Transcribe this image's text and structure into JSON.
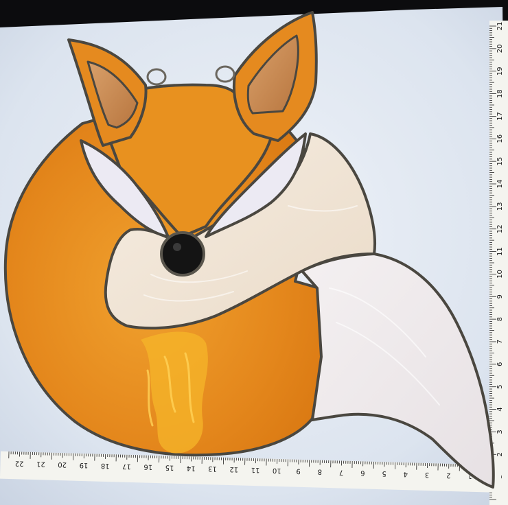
{
  "photo": {
    "subject": "stained-glass-fox",
    "colors": {
      "lightbox": "#dfe7f2",
      "amber_glass": "#e58a1f",
      "amber_highlight": "#f6b82a",
      "cream_glass": "#f1e5d7",
      "white_glass": "#efeaec",
      "ear_inner": "#c98a55",
      "nose": "#141414",
      "lead_came": "#4a4740",
      "ruler": "#f4f4ef"
    }
  },
  "rulers": {
    "right": {
      "labels": [
        "1",
        "2",
        "3",
        "4",
        "5",
        "6",
        "7",
        "8",
        "9",
        "10",
        "11",
        "12",
        "13",
        "14",
        "15",
        "16",
        "17",
        "18",
        "19",
        "20",
        "21"
      ]
    },
    "bottom": {
      "labels": [
        "1",
        "2",
        "3",
        "4",
        "5",
        "6",
        "7",
        "8",
        "9",
        "10",
        "11",
        "12",
        "13",
        "14",
        "15",
        "16",
        "17",
        "18",
        "19",
        "20",
        "21",
        "22"
      ]
    }
  }
}
